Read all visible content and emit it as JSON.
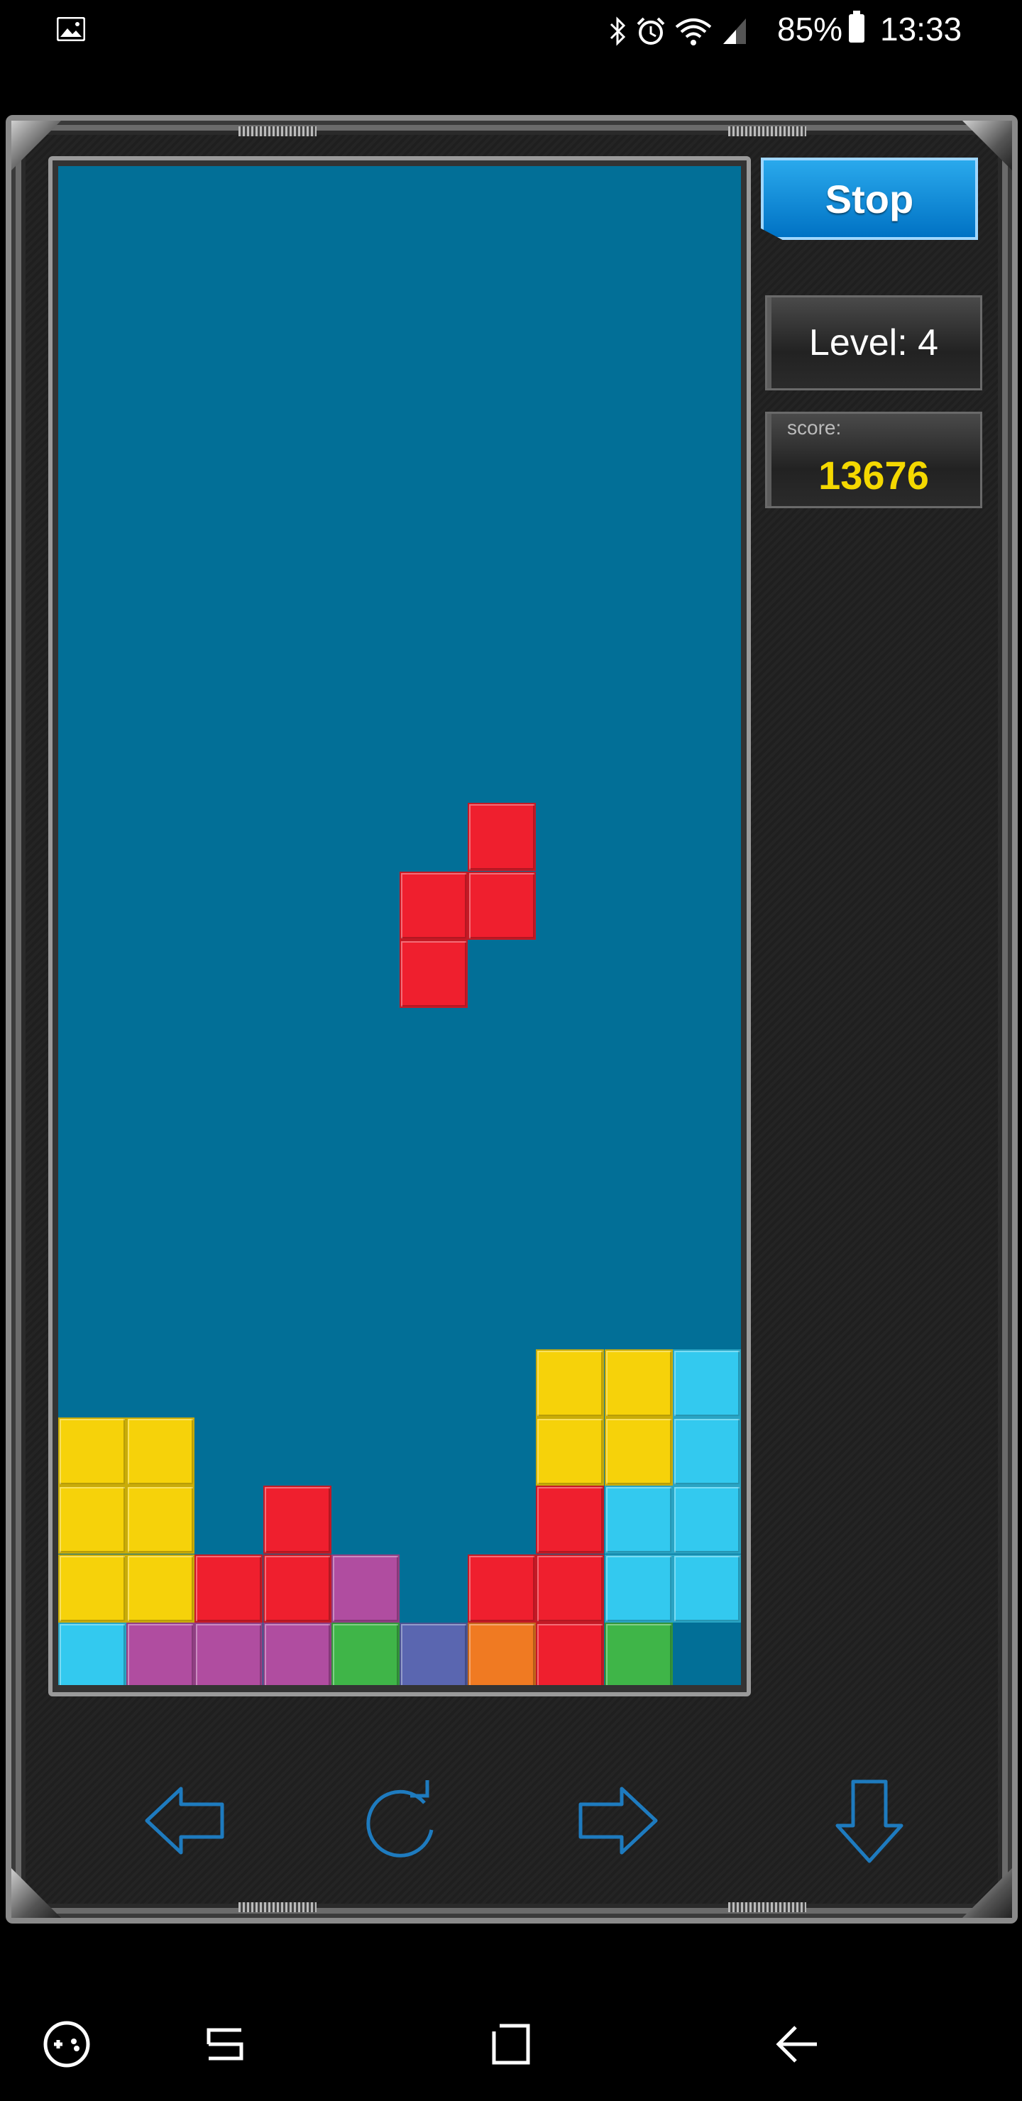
{
  "status_bar": {
    "battery": "85%",
    "time": "13:33",
    "icons": [
      "gallery-icon",
      "bluetooth-icon",
      "alarm-icon",
      "wifi-icon",
      "signal-icon",
      "battery-icon"
    ]
  },
  "sidebar": {
    "stop_label": "Stop",
    "level_text": "Level: 4",
    "score_label": "score:",
    "score_value": "13676"
  },
  "colors": {
    "board": "#026f97",
    "yellow": "#f6d20a",
    "red": "#ef1f2e",
    "cyan": "#33c9ef",
    "purple": "#b04da0",
    "green": "#3fb548",
    "blue": "#5a66b0",
    "orange": "#f07a22",
    "score": "#f4d800",
    "control_icon": "#1e7bbf"
  },
  "board": {
    "columns": 10,
    "rows": 22,
    "falling_piece": {
      "shape": "S-vertical",
      "color": "red",
      "cells": [
        [
          6,
          11
        ],
        [
          5,
          12
        ],
        [
          6,
          12
        ],
        [
          5,
          13
        ]
      ]
    },
    "stack": [
      {
        "col": 7,
        "row": 19,
        "color": "yellow"
      },
      {
        "col": 8,
        "row": 19,
        "color": "yellow"
      },
      {
        "col": 9,
        "row": 19,
        "color": "cyan"
      },
      {
        "col": 0,
        "row": 20,
        "color": "yellow"
      },
      {
        "col": 1,
        "row": 20,
        "color": "yellow"
      },
      {
        "col": 7,
        "row": 20,
        "color": "yellow"
      },
      {
        "col": 8,
        "row": 20,
        "color": "yellow"
      },
      {
        "col": 9,
        "row": 20,
        "color": "cyan"
      },
      {
        "col": 0,
        "row": 21,
        "color": "yellow"
      },
      {
        "col": 1,
        "row": 21,
        "color": "yellow"
      },
      {
        "col": 3,
        "row": 21,
        "color": "red"
      },
      {
        "col": 7,
        "row": 21,
        "color": "red"
      },
      {
        "col": 8,
        "row": 21,
        "color": "cyan"
      },
      {
        "col": 9,
        "row": 21,
        "color": "cyan"
      },
      {
        "col": 0,
        "row": 22,
        "color": "yellow"
      },
      {
        "col": 1,
        "row": 22,
        "color": "yellow"
      },
      {
        "col": 2,
        "row": 22,
        "color": "red"
      },
      {
        "col": 3,
        "row": 22,
        "color": "red"
      },
      {
        "col": 4,
        "row": 22,
        "color": "purple"
      },
      {
        "col": 6,
        "row": 22,
        "color": "red"
      },
      {
        "col": 7,
        "row": 22,
        "color": "red"
      },
      {
        "col": 8,
        "row": 22,
        "color": "cyan"
      },
      {
        "col": 9,
        "row": 22,
        "color": "cyan"
      },
      {
        "col": 0,
        "row": 23,
        "color": "cyan"
      },
      {
        "col": 1,
        "row": 23,
        "color": "purple"
      },
      {
        "col": 2,
        "row": 23,
        "color": "purple"
      },
      {
        "col": 3,
        "row": 23,
        "color": "purple"
      },
      {
        "col": 4,
        "row": 23,
        "color": "green"
      },
      {
        "col": 5,
        "row": 23,
        "color": "blue"
      },
      {
        "col": 6,
        "row": 23,
        "color": "orange"
      },
      {
        "col": 7,
        "row": 23,
        "color": "red"
      },
      {
        "col": 8,
        "row": 23,
        "color": "green"
      }
    ]
  },
  "controls": [
    "move-left-icon",
    "rotate-icon",
    "move-right-icon",
    "drop-down-icon"
  ],
  "nav_bar": [
    "game-launcher-icon",
    "recent-apps-icon",
    "home-icon",
    "back-icon"
  ]
}
